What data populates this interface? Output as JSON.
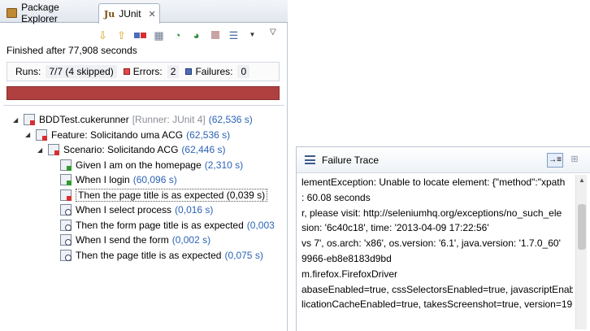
{
  "tabs": [
    {
      "label": "Package Explorer",
      "icon": "package-explorer-icon"
    },
    {
      "label": "JUnit",
      "icon": "junit-icon",
      "close": "✕"
    }
  ],
  "toolbar": {
    "icons": [
      "next-failure-icon",
      "previous-failure-icon",
      "show-failures-only-icon",
      "scroll-lock-icon",
      "rerun-test-icon",
      "rerun-failed-first-icon",
      "stop-icon",
      "test-run-history-icon"
    ]
  },
  "status": "Finished after 77,908 seconds",
  "counters": {
    "runs_label": "Runs:",
    "runs_value": "7/7 (4 skipped)",
    "errors_label": "Errors:",
    "errors_value": "2",
    "failures_label": "Failures:",
    "failures_value": "0"
  },
  "progress": {
    "fraction": 1.0,
    "color": "#b04040"
  },
  "tree": [
    {
      "label": "BDDTest.cukerunner",
      "meta": "[Runner: JUnit 4]",
      "time": "(62,536 s)",
      "status": "error"
    },
    {
      "label": "Feature: Solicitando uma ACG",
      "time": "(62,536 s)",
      "status": "error"
    },
    {
      "label": "Scenario: Solicitando ACG",
      "time": "(62,446 s)",
      "status": "error"
    },
    {
      "label": "Given I am on the homepage",
      "time": "(2,310 s)",
      "status": "ok"
    },
    {
      "label": "When I login",
      "time": "(60,096 s)",
      "status": "ok"
    },
    {
      "label": "Then the page title is as expected (0,039 s)",
      "time": "",
      "status": "error",
      "selected": true
    },
    {
      "label": "When I select process",
      "time": "(0,016 s)",
      "status": "skip"
    },
    {
      "label": "Then the form page title is as expected",
      "time": "(0,003",
      "status": "skip"
    },
    {
      "label": "When I send the form",
      "time": "(0,002 s)",
      "status": "skip"
    },
    {
      "label": "Then the page title is as expected",
      "time": "(0,075 s)",
      "status": "skip"
    }
  ],
  "failure_trace": {
    "title": "Failure Trace",
    "lines": [
      "lementException: Unable to locate element: {\"method\":\"xpath",
      ": 60.08 seconds",
      "r, please visit: http://seleniumhq.org/exceptions/no_such_ele",
      "sion: '6c40c18', time: '2013-04-09 17:22:56'",
      "vs 7', os.arch: 'x86', os.version: '6.1', java.version: '1.7.0_60'",
      "9966-eb8e8183d9bd",
      "m.firefox.FirefoxDriver",
      "abaseEnabled=true, cssSelectorsEnabled=true, javascriptEnab",
      "licationCacheEnabled=true, takesScreenshot=true, version=19"
    ]
  }
}
